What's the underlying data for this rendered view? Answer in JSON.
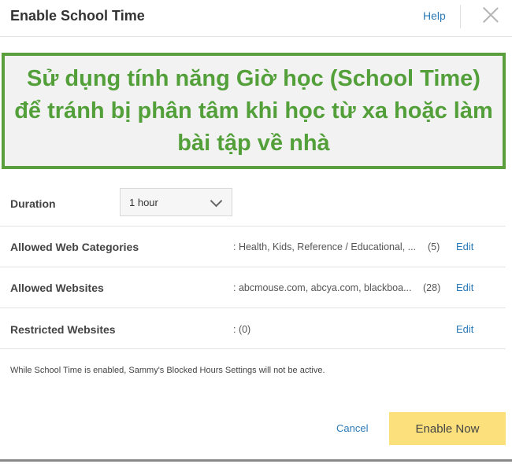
{
  "dialog": {
    "title": "Enable School Time",
    "help_label": "Help"
  },
  "banner": {
    "text": "Sử dụng tính năng Giờ học (School Time) để tránh bị phân tâm khi học từ xa hoặc làm bài tập về nhà"
  },
  "duration": {
    "label": "Duration",
    "selected": "1 hour"
  },
  "rows": [
    {
      "label": "Allowed Web Categories",
      "value": ": Health, Kids, Reference / Educational, ...",
      "count": "(5)",
      "edit": "Edit"
    },
    {
      "label": "Allowed Websites",
      "value": ": abcmouse.com, abcya.com, blackboa...",
      "count": "(28)",
      "edit": "Edit"
    },
    {
      "label": "Restricted Websites",
      "value": ": (0)",
      "count": "",
      "edit": "Edit"
    }
  ],
  "note": "While School Time is enabled, Sammy's Blocked Hours Settings will not be active.",
  "actions": {
    "cancel_label": "Cancel",
    "enable_label": "Enable Now"
  }
}
